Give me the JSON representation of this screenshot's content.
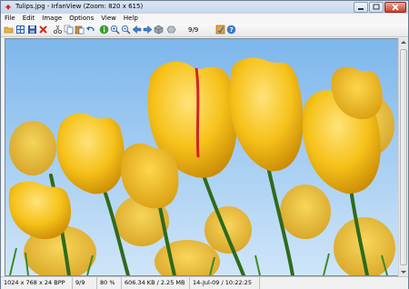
{
  "window": {
    "title": "Tulips.jpg - IrfanView (Zoom: 820 x 615)"
  },
  "menu": [
    {
      "label": "File"
    },
    {
      "label": "Edit"
    },
    {
      "label": "Image"
    },
    {
      "label": "Options"
    },
    {
      "label": "View"
    },
    {
      "label": "Help"
    }
  ],
  "toolbar": {
    "page_indicator": "9/9",
    "icons": [
      "open-folder-icon",
      "thumbnails-icon",
      "save-icon",
      "delete-icon",
      "cut-icon",
      "copy-icon",
      "paste-icon",
      "undo-icon",
      "info-icon",
      "zoom-in-icon",
      "zoom-out-icon",
      "previous-icon",
      "next-icon",
      "slideshow-icon",
      "options-icon",
      "help-icon"
    ]
  },
  "image": {
    "name": "Tulips",
    "sky_color": "#9ccaf1",
    "petal_color": "#f6c21a",
    "stem_color": "#2f6a1c"
  },
  "status": {
    "dimensions": "1024 x 768 x 24 BPP",
    "position": "9/9",
    "zoom": "80 %",
    "size": "606.34 KB / 2.25 MB",
    "date": "14-Jul-09 / 10:22:25"
  }
}
